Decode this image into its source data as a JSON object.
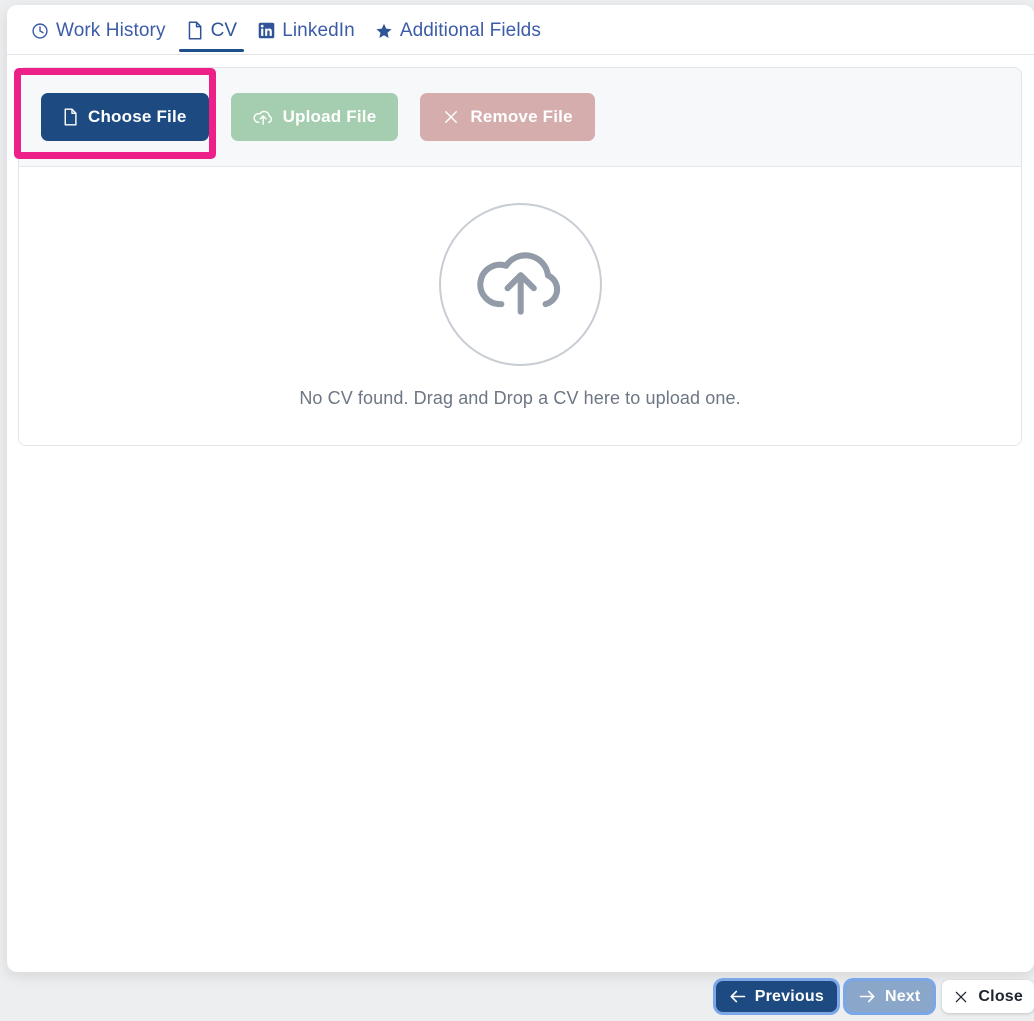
{
  "tabs": [
    {
      "id": "work-history",
      "label": "Work History",
      "icon": "clock-icon",
      "active": false
    },
    {
      "id": "cv",
      "label": "CV",
      "icon": "file-icon",
      "active": true
    },
    {
      "id": "linkedin",
      "label": "LinkedIn",
      "icon": "linkedin-icon",
      "active": false
    },
    {
      "id": "additional-fields",
      "label": "Additional Fields",
      "icon": "star-icon",
      "active": false
    }
  ],
  "toolbar": {
    "choose_file_label": "Choose File",
    "choose_file_icon": "file-icon",
    "upload_file_label": "Upload File",
    "upload_file_icon": "cloud-upload-icon",
    "remove_file_label": "Remove File",
    "remove_file_icon": "close-x-icon"
  },
  "dropzone": {
    "icon": "cloud-upload-icon",
    "message": "No CV found. Drag and Drop a CV here to upload one."
  },
  "footer": {
    "previous_label": "Previous",
    "previous_icon": "arrow-left-icon",
    "next_label": "Next",
    "next_icon": "arrow-right-icon",
    "close_label": "Close",
    "close_icon": "close-x-icon"
  },
  "colors": {
    "primary_navy": "#1d4a80",
    "tab_blue": "#3c5ca8",
    "upload_green": "#a5cdb0",
    "remove_rose": "#d5adad",
    "highlight_pink": "#ec2088",
    "next_blue": "#8aa6c9",
    "toolbar_bg": "#f7f8fa",
    "page_bg": "#eceef0",
    "muted_text": "#6d7684",
    "icon_gray": "#939ba8"
  }
}
